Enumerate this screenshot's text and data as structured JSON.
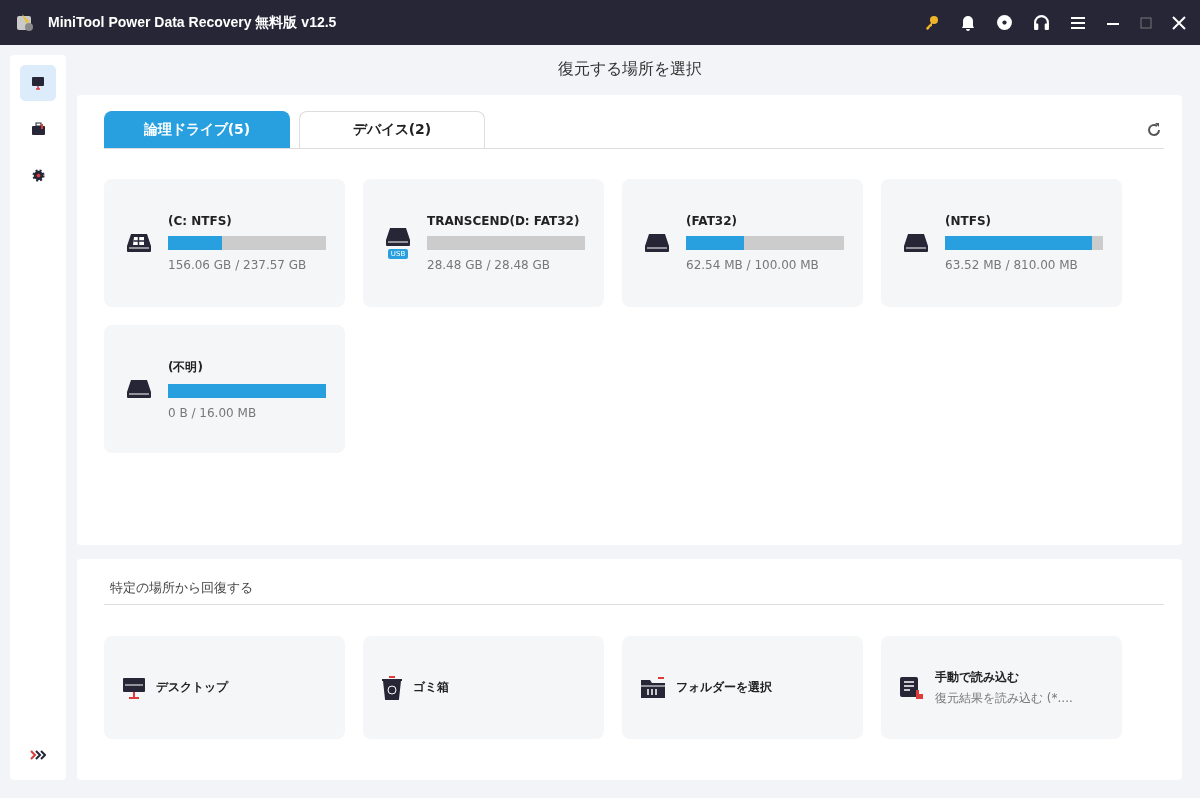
{
  "window": {
    "title": "MiniTool Power Data Recovery 無料版 v12.5"
  },
  "sidebar": {
    "items": [
      {
        "kind": "monitor",
        "selected": true
      },
      {
        "kind": "toolbox",
        "selected": false
      },
      {
        "kind": "gear",
        "selected": false
      }
    ]
  },
  "heading": "復元する場所を選択",
  "tabs": [
    {
      "label": "論理ドライブ(5)",
      "selected": true
    },
    {
      "label": "デバイス(2)",
      "selected": false
    }
  ],
  "drives": [
    {
      "name": "(C: NTFS)",
      "kind": "windows",
      "level": 0.34,
      "size": "156.06 GB / 237.57 GB"
    },
    {
      "name": "TRANSCEND(D: FAT32)",
      "kind": "usb",
      "badge": "USB",
      "level": 0,
      "size": "28.48 GB / 28.48 GB"
    },
    {
      "name": "(FAT32)",
      "kind": "plain",
      "level": 0.37,
      "size": "62.54 MB / 100.00 MB"
    },
    {
      "name": "(NTFS)",
      "kind": "plain",
      "level": 0.93,
      "size": "63.52 MB / 810.00 MB"
    },
    {
      "name": "(不明)",
      "kind": "plain",
      "level": 1,
      "size": "0 B / 16.00 MB"
    }
  ],
  "locations_section": {
    "title": "特定の場所から回復する",
    "items": [
      {
        "kind": "desktop",
        "label": "デスクトップ"
      },
      {
        "kind": "bin",
        "label": "ゴミ箱"
      },
      {
        "kind": "folder",
        "label": "フォルダーを選択"
      },
      {
        "kind": "load",
        "label": "手動で読み込む",
        "subtitle": "復元結果を読み込む (*...."
      }
    ]
  }
}
